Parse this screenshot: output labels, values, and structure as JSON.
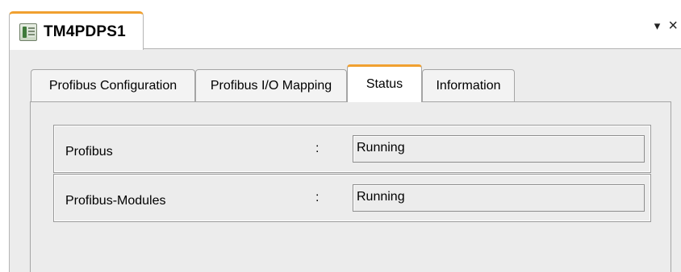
{
  "document_tab": {
    "title": "TM4PDPS1",
    "icon": "device-module-icon"
  },
  "window_controls": {
    "dropdown": "▾",
    "close": "×"
  },
  "tabs": [
    {
      "label": "Profibus Configuration",
      "active": false
    },
    {
      "label": "Profibus I/O Mapping",
      "active": false
    },
    {
      "label": "Status",
      "active": true
    },
    {
      "label": "Information",
      "active": false
    }
  ],
  "status_rows": [
    {
      "label": "Profibus",
      "separator": ":",
      "value": "Running"
    },
    {
      "label": "Profibus-Modules",
      "separator": ":",
      "value": "Running"
    }
  ],
  "colors": {
    "accent": "#f0a030",
    "panel": "#ececec",
    "border": "#a5a5a5"
  }
}
